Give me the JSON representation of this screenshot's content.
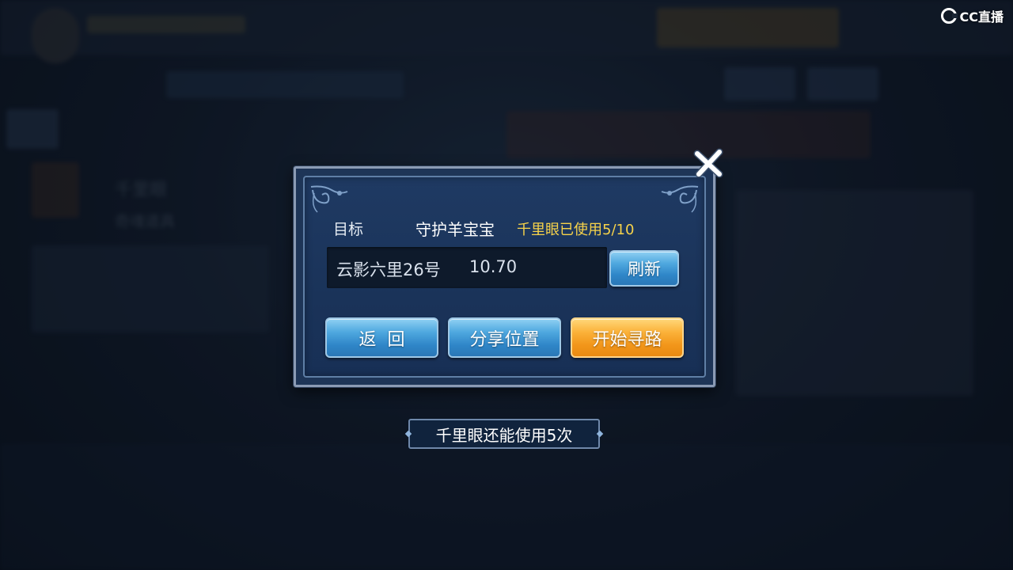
{
  "watermark": {
    "text": "CC直播"
  },
  "dialog": {
    "target_label": "目标",
    "target_name": "守护羊宝宝",
    "usage_text": "千里眼已使用5/10",
    "location": {
      "name": "云影六里26号",
      "coordinate": "10.70"
    },
    "buttons": {
      "refresh": "刷新",
      "back": "返回",
      "share_location": "分享位置",
      "start_pathfinding": "开始寻路"
    }
  },
  "tip": {
    "remaining_text": "千里眼还能使用5次"
  },
  "background": {
    "item_title": "千里眼",
    "item_type": "奇魂道具"
  },
  "colors": {
    "usage_text": "#f7d34a",
    "button_blue": "#2f86c8",
    "button_orange": "#f2961a",
    "dialog_bg": "#1f3a63"
  },
  "icons": {
    "close": "close-x-icon",
    "watermark": "cc-logo-icon"
  }
}
